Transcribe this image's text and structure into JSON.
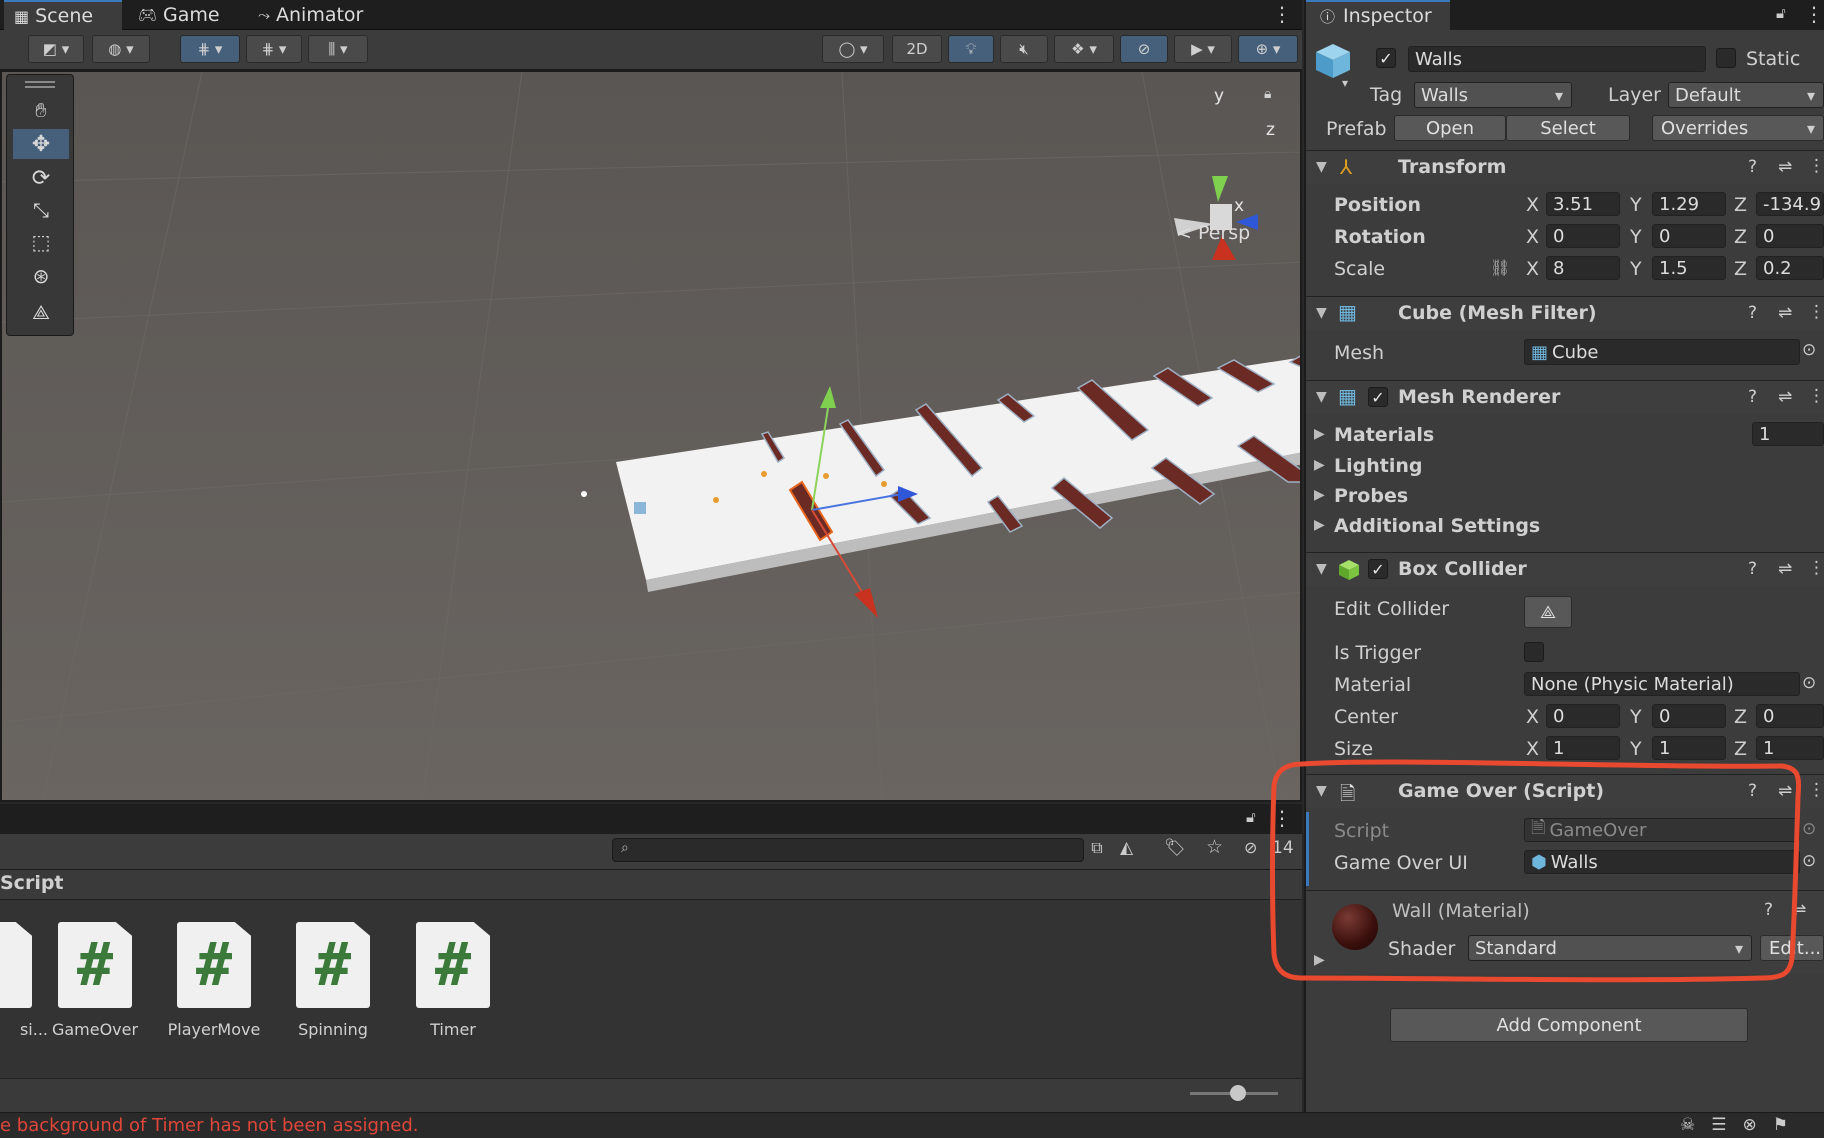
{
  "tabs": {
    "scene": "Scene",
    "game": "Game",
    "animator": "Animator"
  },
  "scene_toolbar": {
    "mode_2d": "2D"
  },
  "gizmo": {
    "x": "x",
    "y": "y",
    "z": "z",
    "persp": "< Persp"
  },
  "project": {
    "breadcrumb": "Script",
    "hidden_count": "14",
    "assets": [
      {
        "name": "si..."
      },
      {
        "name": "GameOver"
      },
      {
        "name": "PlayerMove"
      },
      {
        "name": "Spinning"
      },
      {
        "name": "Timer"
      }
    ],
    "asset_glyph": "#"
  },
  "status": {
    "message": "e background of Timer has not been assigned.",
    "color": "#e0463a"
  },
  "inspector": {
    "tab": "Inspector",
    "object": {
      "name": "Walls",
      "static_label": "Static",
      "tag_label": "Tag",
      "tag_value": "Walls",
      "layer_label": "Layer",
      "layer_value": "Default"
    },
    "prefab": {
      "label": "Prefab",
      "open": "Open",
      "select": "Select",
      "overrides": "Overrides"
    },
    "transform": {
      "title": "Transform",
      "position": {
        "label": "Position",
        "x": "3.51",
        "y": "1.29",
        "z": "-134.9"
      },
      "rotation": {
        "label": "Rotation",
        "x": "0",
        "y": "0",
        "z": "0"
      },
      "scale": {
        "label": "Scale",
        "x": "8",
        "y": "1.5",
        "z": "0.2"
      }
    },
    "axis": {
      "x": "X",
      "y": "Y",
      "z": "Z"
    },
    "mesh_filter": {
      "title": "Cube (Mesh Filter)",
      "mesh_label": "Mesh",
      "mesh_value": "Cube"
    },
    "mesh_renderer": {
      "title": "Mesh Renderer",
      "materials": "Materials",
      "materials_count": "1",
      "lighting": "Lighting",
      "probes": "Probes",
      "additional": "Additional Settings"
    },
    "box_collider": {
      "title": "Box Collider",
      "edit_collider": "Edit Collider",
      "is_trigger": "Is Trigger",
      "material_label": "Material",
      "material_value": "None (Physic Material)",
      "center": {
        "label": "Center",
        "x": "0",
        "y": "0",
        "z": "0"
      },
      "size": {
        "label": "Size",
        "x": "1",
        "y": "1",
        "z": "1"
      }
    },
    "game_over": {
      "title": "Game Over (Script)",
      "script_label": "Script",
      "script_value": "GameOver",
      "ui_label": "Game Over UI",
      "ui_value": "Walls"
    },
    "material": {
      "title": "Wall (Material)",
      "shader_label": "Shader",
      "shader_value": "Standard",
      "edit": "Edit..."
    },
    "add_component": "Add Component",
    "highlight_color": "#e8492f"
  }
}
